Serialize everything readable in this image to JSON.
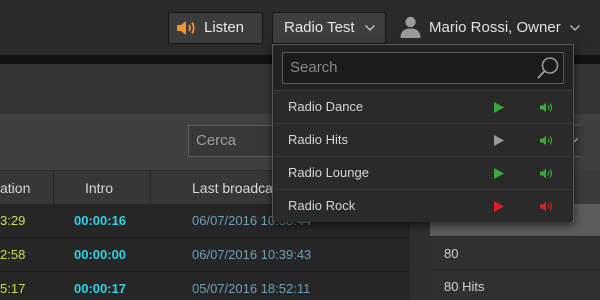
{
  "header": {
    "listen_label": "Listen",
    "radio_selector_label": "Radio Test",
    "user_label": "Mario Rossi, Owner"
  },
  "dropdown": {
    "search_placeholder": "Search",
    "items": [
      {
        "name": "Radio Dance",
        "play_color": "#3aa83a",
        "volume_color": "#3aa83a"
      },
      {
        "name": "Radio Hits",
        "play_color": "#9a9a9a",
        "volume_color": "#3aa83a"
      },
      {
        "name": "Radio Lounge",
        "play_color": "#3aa83a",
        "volume_color": "#3aa83a"
      },
      {
        "name": "Radio Rock",
        "play_color": "#e02020",
        "volume_color": "#e02020"
      }
    ]
  },
  "toolbar": {
    "search_placeholder": "Cerca"
  },
  "table": {
    "columns": [
      "ation",
      "Intro",
      "Last broadca"
    ],
    "rows": [
      {
        "duration": "3:29",
        "intro": "00:00:16",
        "last_broadcast": "06/07/2016 10:38:44"
      },
      {
        "duration": "2:58",
        "intro": "00:00:00",
        "last_broadcast": "06/07/2016 10:39:43"
      },
      {
        "duration": "5:17",
        "intro": "00:00:17",
        "last_broadcast": "05/07/2016 18:52:11"
      }
    ]
  },
  "right_list": {
    "items": [
      "80",
      "80 Hits"
    ]
  },
  "colors": {
    "accent_orange": "#f0962a",
    "duration_text": "#c7e05a",
    "intro_text": "#33d1e6",
    "date_text": "#6f9fb5"
  },
  "icons": {
    "listen": "speaker-icon",
    "radio_selector": "chevron-down-icon",
    "user": "user-icon",
    "search": "magnifier-icon",
    "play": "play-icon",
    "volume": "volume-icon"
  }
}
